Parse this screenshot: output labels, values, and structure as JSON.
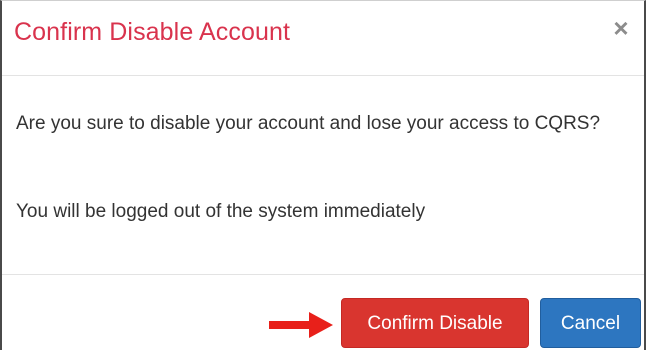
{
  "modal": {
    "title": "Confirm Disable Account",
    "close_label": "×",
    "question": "Are you sure to disable your account and lose your access to CQRS?",
    "notice": "You will be logged out of the system immediately"
  },
  "footer": {
    "confirm_label": "Confirm Disable",
    "cancel_label": "Cancel"
  },
  "colors": {
    "title": "#d9334d",
    "confirm_button": "#d9352f",
    "cancel_button": "#2d76c0",
    "arrow": "#e8201a"
  }
}
